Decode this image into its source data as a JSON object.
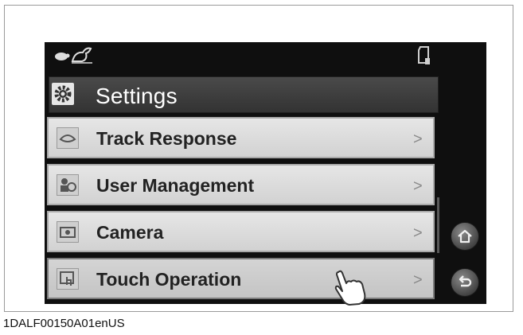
{
  "screen": {
    "title": "Settings",
    "title_icon": "gear-icon",
    "status_icons": [
      "turtle-icon",
      "rabbit-icon",
      "sd-card-icon"
    ],
    "menu_items": [
      {
        "label": "Track Response",
        "icon": "track-response-icon",
        "arrow": ">"
      },
      {
        "label": "User Management",
        "icon": "user-management-icon",
        "arrow": ">"
      },
      {
        "label": "Camera",
        "icon": "camera-icon",
        "arrow": ">"
      },
      {
        "label": "Touch Operation",
        "icon": "touch-operation-icon",
        "arrow": ">",
        "pressed": true
      }
    ],
    "side_buttons": [
      "home-icon",
      "back-icon"
    ]
  },
  "caption": "1DALF00150A01enUS",
  "colors": {
    "screen_bg": "#0f0f0f",
    "title_bar": "#3c3c3c",
    "menu_item": "#dcdcdc",
    "text": "#222222"
  }
}
